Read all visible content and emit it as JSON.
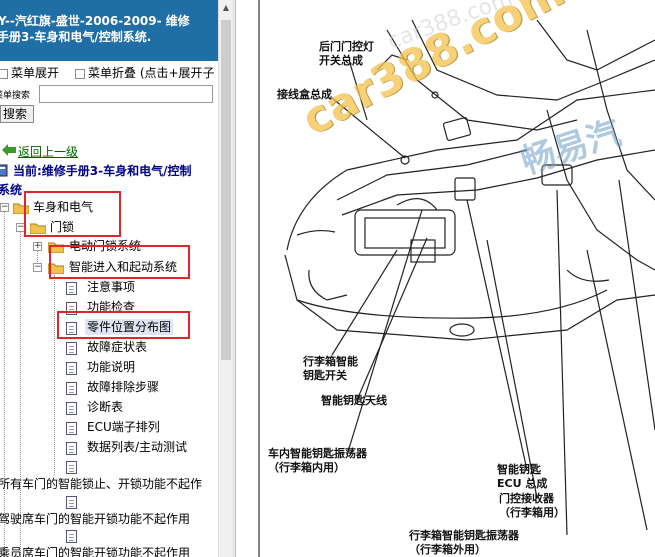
{
  "header": {
    "title_line1": "Y--汽红旗-盛世-2006-2009- 维修",
    "title_line2": "手册3-车身和电气/控制系统."
  },
  "menu": {
    "expand_label": "菜单展开",
    "collapse_label": "菜单折叠 (点击+展开子"
  },
  "search": {
    "label": "菜单搜索",
    "placeholder": "",
    "button_label": "搜索"
  },
  "nav": {
    "back_label": "返回上一级",
    "current_line1": "当前:维修手册3-车身和电气/控制",
    "current_line2": "系统"
  },
  "tree": {
    "root": "车身和电气",
    "door_lock": "门锁",
    "power_lock": "电动门锁系统",
    "smart_entry": "智能进入和起动系统",
    "items": [
      "注意事项",
      "功能检查",
      "零件位置分布图",
      "故障症状表",
      "功能说明",
      "故障排除步骤",
      "诊断表",
      "ECU端子排列",
      "数据列表/主动测试"
    ],
    "long_items": [
      "所有车门的智能锁止、开锁功能不起作",
      "驾驶席车门的智能开锁功能不起作用",
      "乘员席车门的智能开锁功能不起作用"
    ]
  },
  "diagram": {
    "labels": {
      "rear_door_courtesy": "后门门控灯\n开关总成",
      "junction_box": "接线盒总成",
      "trunk_key_switch": "行李箱智能\n钥匙开关",
      "smart_key_antenna": "智能钥匙天线",
      "cabin_oscillator": "车内智能钥匙振荡器\n（行李箱内用）",
      "smart_key_ecu": "智能钥匙\nECU 总成",
      "door_receiver": "门控接收器\n（行李箱用）",
      "trunk_oscillator": "行李箱智能钥匙振荡器\n（行李箱外用）"
    },
    "watermark_main": "car388.com",
    "watermark_brand": "畅易汽",
    "watermark_faint": "car388.com"
  },
  "colors": {
    "title_bg": "#1f6fa6",
    "highlight": "#e0262b",
    "back_link": "#006600",
    "current": "#000088"
  }
}
